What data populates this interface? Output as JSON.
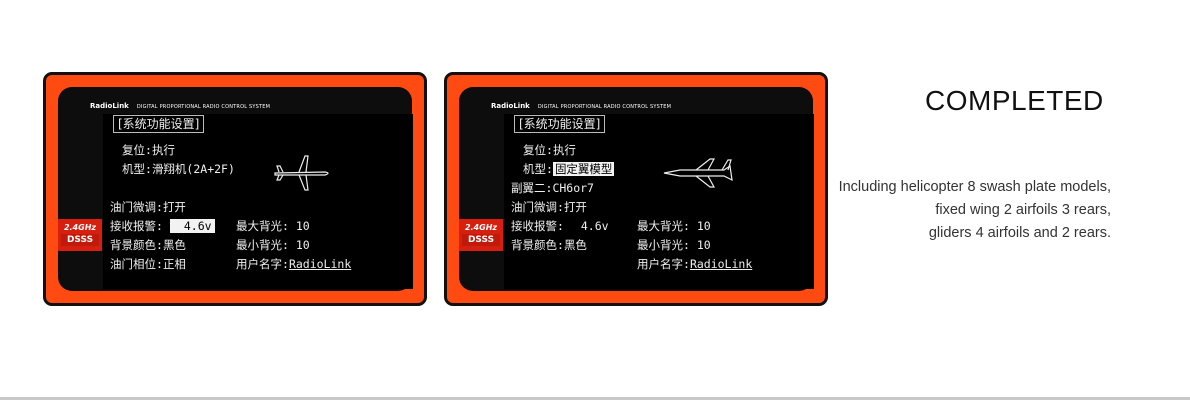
{
  "screens": [
    {
      "brand": "RadioLink",
      "tagline": "DIGITAL PROPORTIONAL RADIO CONTROL SYSTEM",
      "logo": {
        "ghz": "2.4GHz",
        "dsss": "DSSS"
      },
      "title": "[系统功能设置]",
      "reset_label": "复位:",
      "reset_value": "执行",
      "model_label": "机型:",
      "model_value": "滑翔机(2A+2F)",
      "throttle_trim_label": "油门微调:",
      "throttle_trim_value": "打开",
      "alarm_label": "接收报警:",
      "alarm_value": "4.6v",
      "color_label": "背景颜色:",
      "color_value": "黑色",
      "phase_label": "油门相位:",
      "phase_value": "正相",
      "max_backlight_label": "最大背光:",
      "max_backlight_value": "10",
      "min_backlight_label": "最小背光:",
      "min_backlight_value": "10",
      "user_label": "用户名字:",
      "user_value": "RadioLink"
    },
    {
      "brand": "RadioLink",
      "tagline": "DIGITAL PROPORTIONAL RADIO CONTROL SYSTEM",
      "logo": {
        "ghz": "2.4GHz",
        "dsss": "DSSS"
      },
      "title": "[系统功能设置]",
      "reset_label": "复位:",
      "reset_value": "执行",
      "model_label": "机型:",
      "model_value": "固定翼模型",
      "aileron_label": "副翼二:",
      "aileron_value": "CH6or7",
      "throttle_trim_label": "油门微调:",
      "throttle_trim_value": "打开",
      "alarm_label": "接收报警:",
      "alarm_value": "4.6v",
      "color_label": "背景颜色:",
      "color_value": "黑色",
      "max_backlight_label": "最大背光:",
      "max_backlight_value": "10",
      "min_backlight_label": "最小背光:",
      "min_backlight_value": "10",
      "user_label": "用户名字:",
      "user_value": "RadioLink"
    }
  ],
  "heading": "COMPLETED",
  "description": [
    "Including helicopter 8 swash plate models,",
    "fixed wing 2 airfoils 3 rears,",
    "gliders 4 airfoils and 2 rears."
  ]
}
